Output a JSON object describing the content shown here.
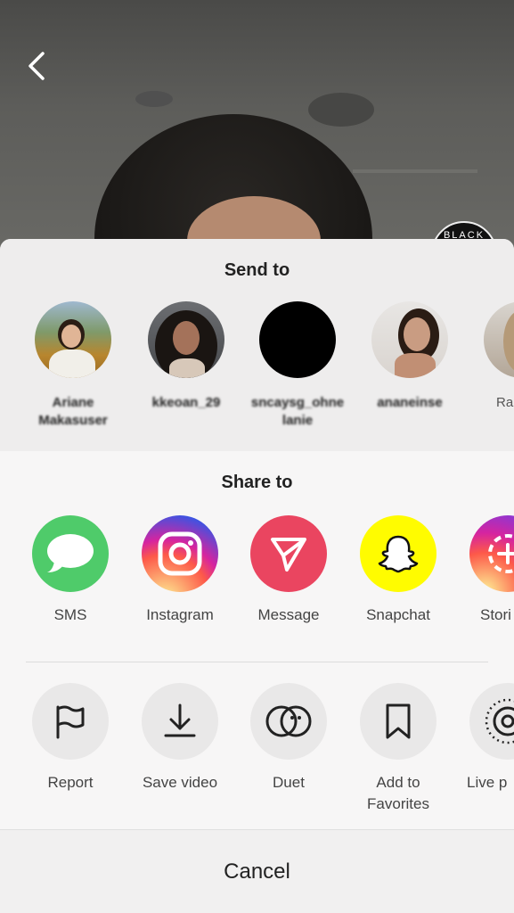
{
  "send_to": {
    "title": "Send to",
    "contacts": [
      {
        "name": "Ariane\nMakasuser"
      },
      {
        "name": "kkeoan_29"
      },
      {
        "name": "sncaysg_ohne\nlanie"
      },
      {
        "name": "ananeinse"
      },
      {
        "name": "Ra"
      }
    ]
  },
  "share_to": {
    "title": "Share to",
    "apps": [
      {
        "label": "SMS",
        "icon": "speech-bubble-icon",
        "color": "#4fcb6a"
      },
      {
        "label": "Instagram",
        "icon": "instagram-icon",
        "color": "#d6249f"
      },
      {
        "label": "Message",
        "icon": "send-arrow-icon",
        "color": "#ea4560"
      },
      {
        "label": "Snapchat",
        "icon": "snapchat-ghost-icon",
        "color": "#fffc00"
      },
      {
        "label": "Stori",
        "icon": "stories-plus-icon",
        "color": "#c13584"
      }
    ]
  },
  "actions": [
    {
      "label": "Report",
      "icon": "flag-icon"
    },
    {
      "label": "Save video",
      "icon": "download-icon"
    },
    {
      "label": "Duet",
      "icon": "duet-icon"
    },
    {
      "label": "Add to\nFavorites",
      "icon": "bookmark-icon"
    },
    {
      "label": "Live p",
      "icon": "live-photo-icon"
    }
  ],
  "cancel_label": "Cancel",
  "badge_text": "BLACK"
}
